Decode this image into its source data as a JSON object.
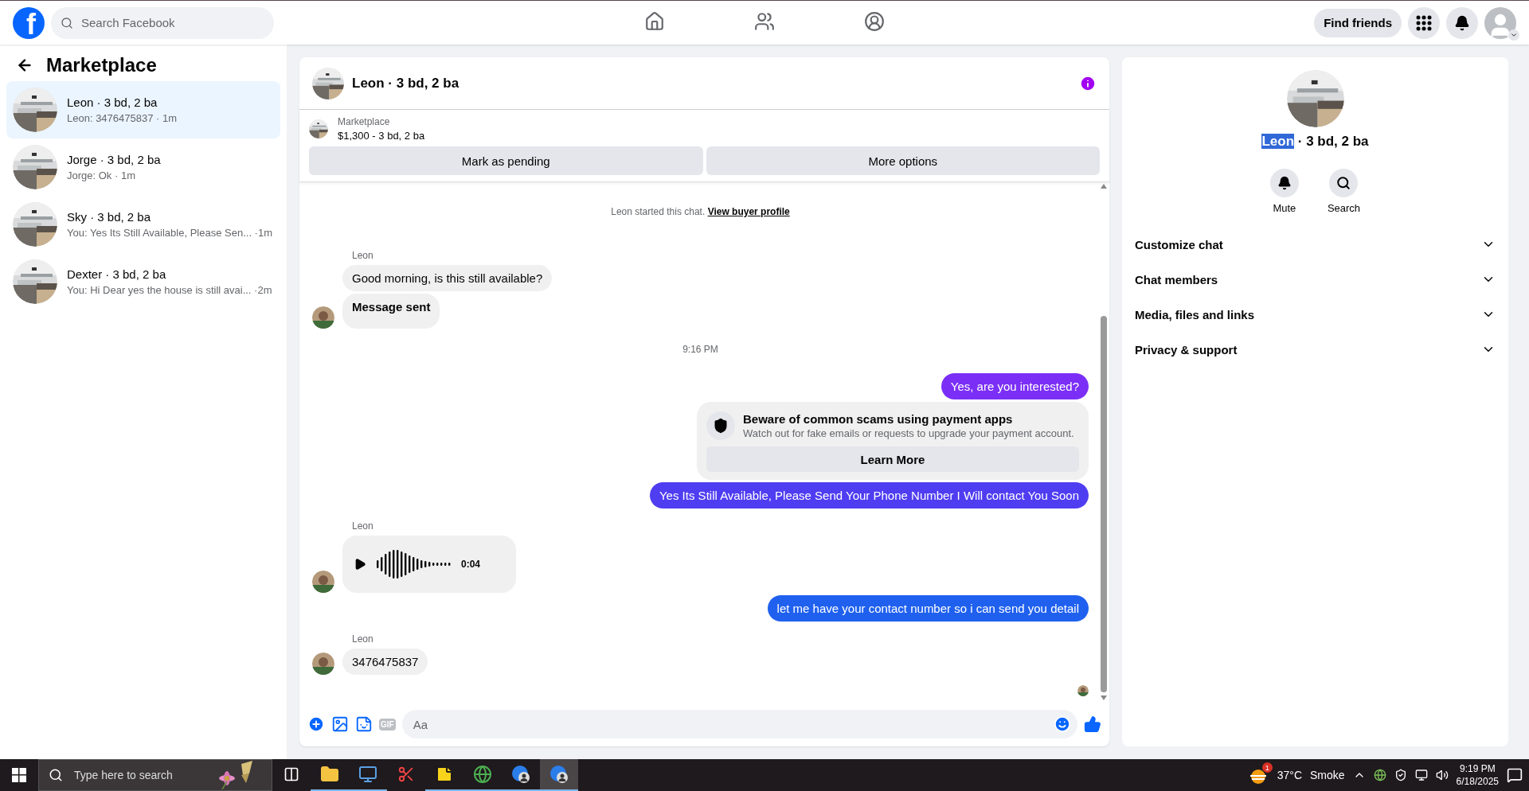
{
  "topbar": {
    "logo": "f",
    "search": {
      "placeholder": "Search Facebook"
    },
    "nav": [
      {
        "kind": "home",
        "selected": false
      },
      {
        "kind": "friends",
        "selected": false
      },
      {
        "kind": "groups",
        "selected": false
      }
    ],
    "find_friends": "Find friends"
  },
  "sidebar": {
    "title": "Marketplace",
    "conversations": [
      {
        "name": "Leon · 3 bd, 2 ba",
        "preview": "Leon: 3476475837 · 1m",
        "selected": true
      },
      {
        "name": "Jorge · 3 bd, 2 ba",
        "preview": "Jorge: Ok · 1m",
        "selected": false
      },
      {
        "name": "Sky · 3 bd, 2 ba",
        "preview": "You: Yes Its Still Available, Please Sen...  ·1m",
        "selected": false
      },
      {
        "name": "Dexter · 3 bd, 2 ba",
        "preview": "You: Hi Dear yes the house is still avai... ·2m",
        "selected": false
      }
    ]
  },
  "chat": {
    "title": "Leon · 3 bd, 2 ba",
    "listing": {
      "source": "Marketplace",
      "summary": "$1,300 - 3 bd, 2 ba"
    },
    "actions": [
      "Mark as pending",
      "More options"
    ],
    "messages": [
      {
        "kind": "system",
        "text": "Leon started this chat.",
        "link": "View buyer profile"
      },
      {
        "kind": "sender",
        "text": "Leon"
      },
      {
        "kind": "incoming",
        "text": "Good morning, is this still available?",
        "avatar": false
      },
      {
        "kind": "status",
        "text": "Message sent",
        "avatar": true
      },
      {
        "kind": "time",
        "text": "9:16 PM"
      },
      {
        "kind": "outgoing",
        "text": "Yes, are you interested?",
        "color": "#7b2ff6"
      },
      {
        "kind": "warning",
        "title": "Beware of common scams using payment apps",
        "body": "Watch out for fake emails or requests to upgrade your payment account.",
        "button": "Learn More"
      },
      {
        "kind": "outgoing",
        "text": "Yes Its Still Available, Please Send Your Phone Number I Will contact You Soon",
        "color": "#4f3df1"
      },
      {
        "kind": "sender",
        "text": "Leon"
      },
      {
        "kind": "audio",
        "duration": "0:04",
        "avatar": true
      },
      {
        "kind": "outgoing",
        "text": "let me have your contact number so i can send you detail",
        "color": "#1f60ef"
      },
      {
        "kind": "sender",
        "text": "Leon"
      },
      {
        "kind": "incoming",
        "text": "3476475837",
        "avatar": true
      },
      {
        "kind": "seen"
      }
    ],
    "composer": {
      "gif": "GIF",
      "placeholder": "Aa"
    }
  },
  "details": {
    "name": "Leon",
    "name_selected": true,
    "rest": "· 3 bd, 2 ba",
    "actions": [
      {
        "kind": "mute",
        "label": "Mute"
      },
      {
        "kind": "search",
        "label": "Search"
      }
    ],
    "sections": [
      {
        "label": "Customize chat",
        "expanded": false
      },
      {
        "label": "Chat members",
        "expanded": false
      },
      {
        "label": "Media, files and links",
        "expanded": false
      },
      {
        "label": "Privacy & support",
        "expanded": false
      }
    ]
  },
  "taskbar": {
    "search": {
      "placeholder": "Type here to search"
    },
    "apps": [
      {
        "kind": "folder",
        "running": true,
        "selected": false
      },
      {
        "kind": "network",
        "running": true,
        "selected": false
      },
      {
        "kind": "snip",
        "running": false,
        "selected": false
      },
      {
        "kind": "sticky",
        "running": true,
        "selected": false
      },
      {
        "kind": "chrome",
        "running": true,
        "selected": false
      },
      {
        "kind": "profile",
        "running": true,
        "selected": false
      },
      {
        "kind": "profile",
        "running": true,
        "selected": true
      }
    ],
    "weather": {
      "badge": "1",
      "temp": "37°C",
      "condition": "Smoke"
    },
    "time": "9:19 PM",
    "date": "6/18/2025"
  }
}
